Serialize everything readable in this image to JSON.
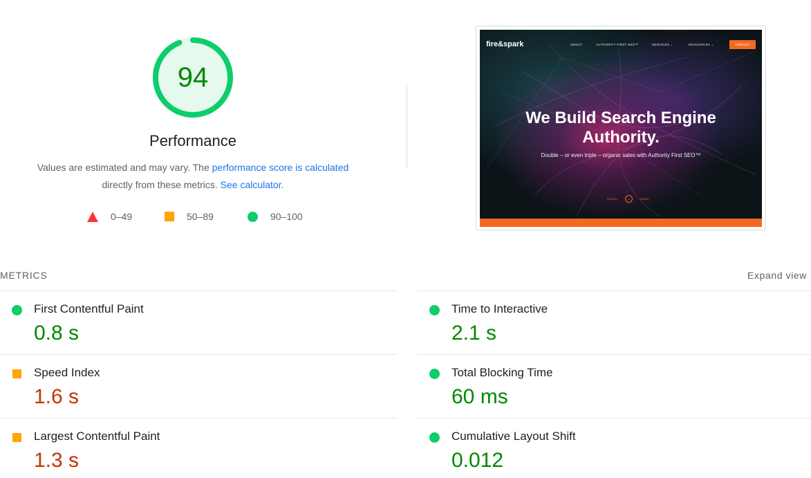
{
  "gauge": {
    "score": "94",
    "score_fraction": 0.94,
    "title": "Performance",
    "color": "#0cce6b"
  },
  "description": {
    "text1": "Values are estimated and may vary. The ",
    "link1": "performance score is calculated",
    "text2": "directly from these metrics. ",
    "link2": "See calculator",
    "text3": "."
  },
  "legend": {
    "fail": "0–49",
    "average": "50–89",
    "pass": "90–100"
  },
  "thumbnail": {
    "logo": "fire&spark",
    "nav": [
      "ABOUT",
      "AUTHORITY FIRST SEO™",
      "SERVICES ⌄",
      "RESOURCES ⌄"
    ],
    "contact": "CONTACT",
    "headline": "We Build Search Engine Authority.",
    "subtitle": "Double – or even triple – organic sales with Authority First SEO™",
    "scroll": "SCROLL",
    "down": "DOWN"
  },
  "metrics": {
    "label": "METRICS",
    "expand_label": "Expand view",
    "items": [
      {
        "label": "First Contentful Paint",
        "value": "0.8 s",
        "status": "pass"
      },
      {
        "label": "Time to Interactive",
        "value": "2.1 s",
        "status": "pass"
      },
      {
        "label": "Speed Index",
        "value": "1.6 s",
        "status": "average"
      },
      {
        "label": "Total Blocking Time",
        "value": "60 ms",
        "status": "pass"
      },
      {
        "label": "Largest Contentful Paint",
        "value": "1.3 s",
        "status": "average"
      },
      {
        "label": "Cumulative Layout Shift",
        "value": "0.012",
        "status": "pass"
      }
    ]
  },
  "colors": {
    "pass": "#0cce6b",
    "pass_text": "#008800",
    "average": "#ffa400",
    "average_text": "#c33300",
    "fail": "#ff3333",
    "link": "#1a73e8"
  }
}
